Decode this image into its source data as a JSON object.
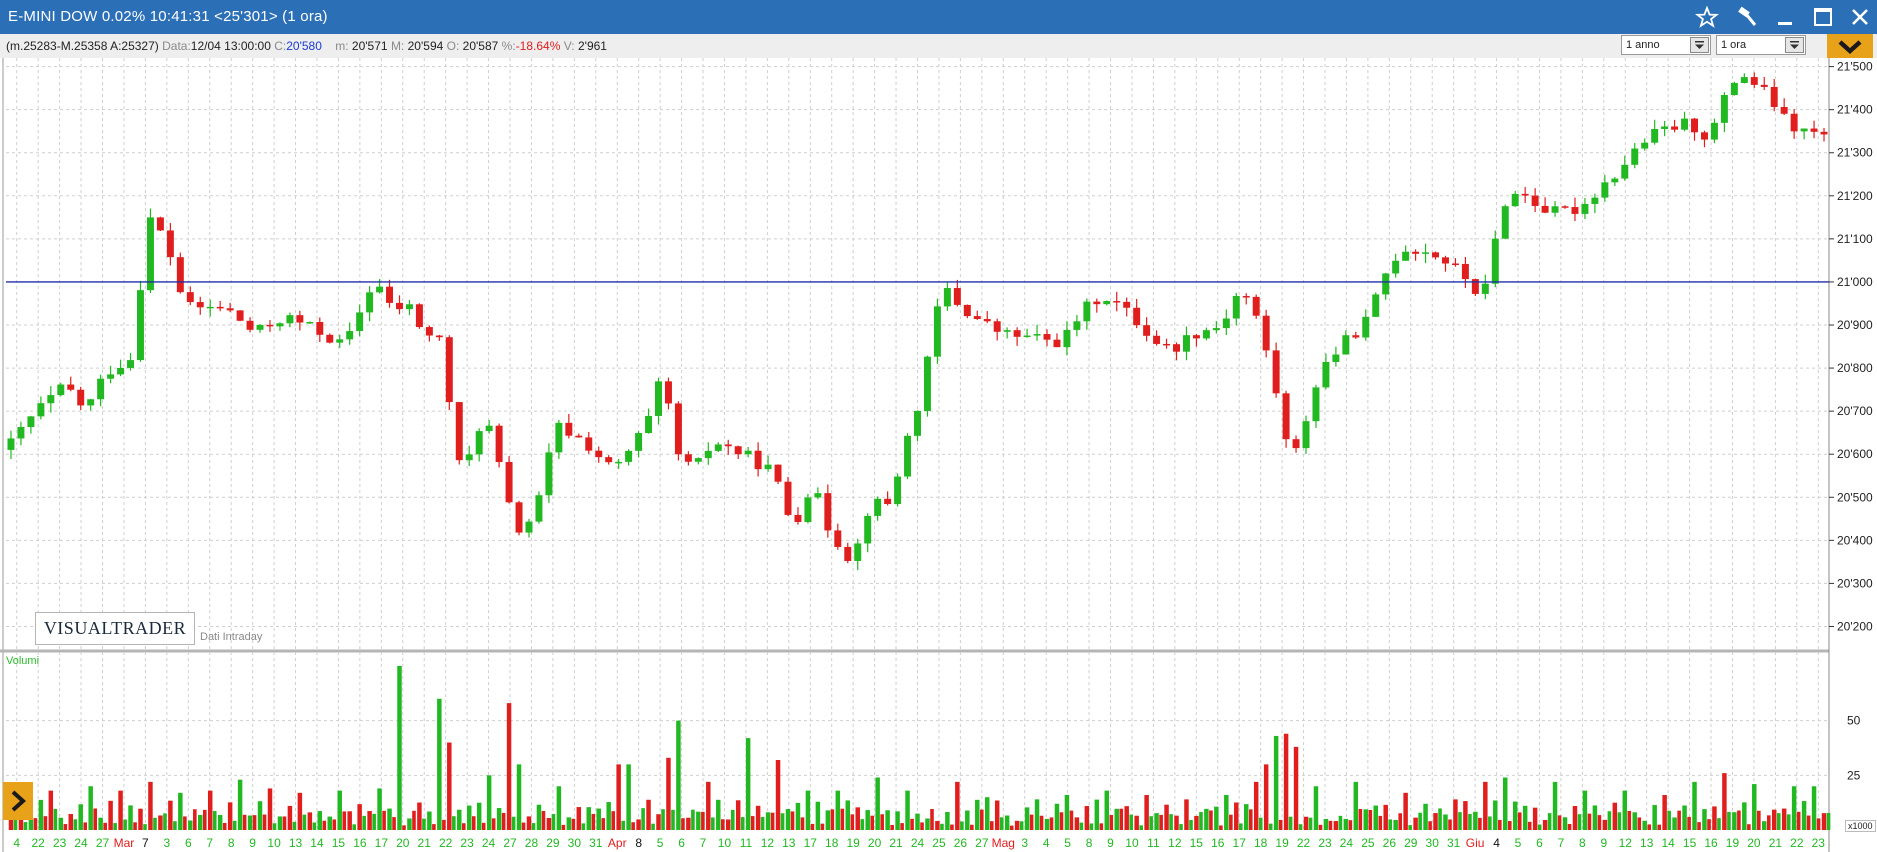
{
  "window": {
    "title": "E-MINI DOW 0.02% 10:41:31  <25'301> (1 ora)",
    "controls": [
      "star-icon",
      "hammer-icon",
      "minimize-icon",
      "maximize-icon",
      "close-icon"
    ]
  },
  "infobar": {
    "range": "(m.25283-M.25358 A:25327)",
    "date_label": "Data:",
    "date_value": "12/04 13:00:00",
    "close_label": "C:",
    "close_value": "20'580",
    "min_label": "m:",
    "min_value": "20'571",
    "max_label": "M:",
    "max_value": "20'594",
    "open_label": "O:",
    "open_value": "20'587",
    "pct_label": "%:",
    "pct_value": "-18.64%",
    "vol_label": "V:",
    "vol_value": "2'961",
    "period_select": "1 anno",
    "interval_select": "1 ora"
  },
  "watermark": {
    "logo": "VISUALTRADER",
    "data_label": "Dati Intraday"
  },
  "volume": {
    "label": "Volumi",
    "multiplier": "x1000"
  },
  "colors": {
    "up": "#22b822",
    "down": "#e01e1e",
    "reference_line": "#1f2ea8",
    "grid": "#cfcfcf",
    "titlebar": "#2b6fb6",
    "accent": "#e8a21a"
  },
  "chart_data": [
    {
      "type": "candlestick",
      "title": "E-MINI DOW",
      "xlabel": "",
      "ylabel": "",
      "ylim": [
        20150,
        21520
      ],
      "y_ticks": [
        20200,
        20300,
        20400,
        20500,
        20600,
        20700,
        20800,
        20900,
        21000,
        21100,
        21200,
        21300,
        21400,
        21500
      ],
      "y_tick_labels": [
        "20'200",
        "20'300",
        "20'400",
        "20'500",
        "20'600",
        "20'700",
        "20'800",
        "20'900",
        "21'000",
        "21'100",
        "21'200",
        "21'300",
        "21'400",
        "21'500"
      ],
      "reference_line": 21000,
      "grid": true,
      "x_tick_labels": [
        {
          "label": "4",
          "color": "green"
        },
        {
          "label": "22",
          "color": "green"
        },
        {
          "label": "23",
          "color": "green"
        },
        {
          "label": "24",
          "color": "green"
        },
        {
          "label": "27",
          "color": "green"
        },
        {
          "label": "Mar",
          "color": "red"
        },
        {
          "label": "7",
          "color": "black"
        },
        {
          "label": "3",
          "color": "green"
        },
        {
          "label": "6",
          "color": "green"
        },
        {
          "label": "7",
          "color": "green"
        },
        {
          "label": "8",
          "color": "green"
        },
        {
          "label": "9",
          "color": "green"
        },
        {
          "label": "10",
          "color": "green"
        },
        {
          "label": "13",
          "color": "green"
        },
        {
          "label": "14",
          "color": "green"
        },
        {
          "label": "15",
          "color": "green"
        },
        {
          "label": "16",
          "color": "green"
        },
        {
          "label": "17",
          "color": "green"
        },
        {
          "label": "20",
          "color": "green"
        },
        {
          "label": "21",
          "color": "green"
        },
        {
          "label": "22",
          "color": "green"
        },
        {
          "label": "23",
          "color": "green"
        },
        {
          "label": "24",
          "color": "green"
        },
        {
          "label": "27",
          "color": "green"
        },
        {
          "label": "28",
          "color": "green"
        },
        {
          "label": "29",
          "color": "green"
        },
        {
          "label": "30",
          "color": "green"
        },
        {
          "label": "31",
          "color": "green"
        },
        {
          "label": "Apr",
          "color": "red"
        },
        {
          "label": "8",
          "color": "black"
        },
        {
          "label": "5",
          "color": "green"
        },
        {
          "label": "6",
          "color": "green"
        },
        {
          "label": "7",
          "color": "green"
        },
        {
          "label": "10",
          "color": "green"
        },
        {
          "label": "11",
          "color": "green"
        },
        {
          "label": "12",
          "color": "green"
        },
        {
          "label": "13",
          "color": "green"
        },
        {
          "label": "17",
          "color": "green"
        },
        {
          "label": "18",
          "color": "green"
        },
        {
          "label": "19",
          "color": "green"
        },
        {
          "label": "20",
          "color": "green"
        },
        {
          "label": "21",
          "color": "green"
        },
        {
          "label": "24",
          "color": "green"
        },
        {
          "label": "25",
          "color": "green"
        },
        {
          "label": "26",
          "color": "green"
        },
        {
          "label": "27",
          "color": "green"
        },
        {
          "label": "Mag",
          "color": "red"
        },
        {
          "label": "3",
          "color": "green"
        },
        {
          "label": "4",
          "color": "green"
        },
        {
          "label": "5",
          "color": "green"
        },
        {
          "label": "8",
          "color": "green"
        },
        {
          "label": "9",
          "color": "green"
        },
        {
          "label": "10",
          "color": "green"
        },
        {
          "label": "11",
          "color": "green"
        },
        {
          "label": "12",
          "color": "green"
        },
        {
          "label": "15",
          "color": "green"
        },
        {
          "label": "16",
          "color": "green"
        },
        {
          "label": "17",
          "color": "green"
        },
        {
          "label": "18",
          "color": "green"
        },
        {
          "label": "19",
          "color": "green"
        },
        {
          "label": "22",
          "color": "green"
        },
        {
          "label": "23",
          "color": "green"
        },
        {
          "label": "24",
          "color": "green"
        },
        {
          "label": "25",
          "color": "green"
        },
        {
          "label": "26",
          "color": "green"
        },
        {
          "label": "29",
          "color": "green"
        },
        {
          "label": "30",
          "color": "green"
        },
        {
          "label": "31",
          "color": "green"
        },
        {
          "label": "Giu",
          "color": "red"
        },
        {
          "label": "4",
          "color": "black"
        },
        {
          "label": "5",
          "color": "green"
        },
        {
          "label": "6",
          "color": "green"
        },
        {
          "label": "7",
          "color": "green"
        },
        {
          "label": "8",
          "color": "green"
        },
        {
          "label": "9",
          "color": "green"
        },
        {
          "label": "12",
          "color": "green"
        },
        {
          "label": "13",
          "color": "green"
        },
        {
          "label": "14",
          "color": "green"
        },
        {
          "label": "15",
          "color": "green"
        },
        {
          "label": "16",
          "color": "green"
        },
        {
          "label": "19",
          "color": "green"
        },
        {
          "label": "20",
          "color": "green"
        },
        {
          "label": "21",
          "color": "green"
        },
        {
          "label": "22",
          "color": "green"
        },
        {
          "label": "23",
          "color": "green"
        }
      ],
      "price_path": [
        [
          0,
          20610
        ],
        [
          3,
          20700
        ],
        [
          6,
          20760
        ],
        [
          8,
          20700
        ],
        [
          10,
          20790
        ],
        [
          13,
          20830
        ],
        [
          14,
          21160
        ],
        [
          16,
          21100
        ],
        [
          18,
          20940
        ],
        [
          22,
          20940
        ],
        [
          25,
          20880
        ],
        [
          28,
          20920
        ],
        [
          31,
          20890
        ],
        [
          34,
          20850
        ],
        [
          37,
          21010
        ],
        [
          39,
          20920
        ],
        [
          40,
          20960
        ],
        [
          42,
          20880
        ],
        [
          44,
          20860
        ],
        [
          45,
          20590
        ],
        [
          46,
          20560
        ],
        [
          48,
          20700
        ],
        [
          49,
          20620
        ],
        [
          51,
          20430
        ],
        [
          52,
          20420
        ],
        [
          54,
          20520
        ],
        [
          55,
          20670
        ],
        [
          58,
          20630
        ],
        [
          61,
          20560
        ],
        [
          63,
          20620
        ],
        [
          65,
          20700
        ],
        [
          66,
          20810
        ],
        [
          67,
          20610
        ],
        [
          69,
          20560
        ],
        [
          71,
          20630
        ],
        [
          74,
          20600
        ],
        [
          77,
          20560
        ],
        [
          79,
          20430
        ],
        [
          81,
          20540
        ],
        [
          82,
          20450
        ],
        [
          84,
          20380
        ],
        [
          85,
          20350
        ],
        [
          87,
          20510
        ],
        [
          88,
          20460
        ],
        [
          89,
          20510
        ],
        [
          90,
          20600
        ],
        [
          92,
          20750
        ],
        [
          94,
          21000
        ],
        [
          95,
          20960
        ],
        [
          97,
          20920
        ],
        [
          100,
          20880
        ],
        [
          103,
          20870
        ],
        [
          106,
          20860
        ],
        [
          108,
          20930
        ],
        [
          110,
          20970
        ],
        [
          111,
          20960
        ],
        [
          113,
          20920
        ],
        [
          115,
          20870
        ],
        [
          117,
          20840
        ],
        [
          119,
          20880
        ],
        [
          122,
          20900
        ],
        [
          124,
          20990
        ],
        [
          126,
          20890
        ],
        [
          127,
          20790
        ],
        [
          128,
          20700
        ],
        [
          129,
          20560
        ],
        [
          130,
          20650
        ],
        [
          131,
          20720
        ],
        [
          132,
          20800
        ],
        [
          134,
          20850
        ],
        [
          137,
          20920
        ],
        [
          138,
          21000
        ],
        [
          140,
          21080
        ],
        [
          143,
          21070
        ],
        [
          145,
          21040
        ],
        [
          147,
          21000
        ],
        [
          148,
          20960
        ],
        [
          149,
          21010
        ],
        [
          150,
          21180
        ],
        [
          152,
          21210
        ],
        [
          155,
          21160
        ],
        [
          158,
          21170
        ],
        [
          160,
          21220
        ],
        [
          162,
          21260
        ],
        [
          164,
          21320
        ],
        [
          166,
          21350
        ],
        [
          169,
          21370
        ],
        [
          171,
          21330
        ],
        [
          172,
          21400
        ],
        [
          174,
          21490
        ],
        [
          177,
          21430
        ],
        [
          179,
          21360
        ],
        [
          182,
          21340
        ]
      ],
      "volume_ylim": [
        0,
        80
      ],
      "volume_ticks": [
        25,
        50
      ],
      "volume_peaks": [
        [
          4,
          18
        ],
        [
          8,
          20
        ],
        [
          11,
          18
        ],
        [
          14,
          22
        ],
        [
          17,
          17
        ],
        [
          20,
          18
        ],
        [
          23,
          23
        ],
        [
          26,
          19
        ],
        [
          29,
          17
        ],
        [
          33,
          18
        ],
        [
          37,
          19
        ],
        [
          39,
          75
        ],
        [
          43,
          60
        ],
        [
          44,
          40
        ],
        [
          48,
          25
        ],
        [
          50,
          58
        ],
        [
          51,
          30
        ],
        [
          55,
          20
        ],
        [
          61,
          30
        ],
        [
          62,
          30
        ],
        [
          66,
          33
        ],
        [
          67,
          50
        ],
        [
          70,
          22
        ],
        [
          74,
          42
        ],
        [
          77,
          32
        ],
        [
          80,
          18
        ],
        [
          83,
          18
        ],
        [
          87,
          24
        ],
        [
          90,
          18
        ],
        [
          95,
          22
        ],
        [
          98,
          15
        ],
        [
          103,
          14
        ],
        [
          106,
          16
        ],
        [
          110,
          18
        ],
        [
          114,
          16
        ],
        [
          118,
          14
        ],
        [
          122,
          16
        ],
        [
          125,
          22
        ],
        [
          126,
          30
        ],
        [
          127,
          43
        ],
        [
          128,
          44
        ],
        [
          129,
          38
        ],
        [
          131,
          20
        ],
        [
          135,
          22
        ],
        [
          140,
          17
        ],
        [
          145,
          14
        ],
        [
          148,
          22
        ],
        [
          150,
          24
        ],
        [
          155,
          22
        ],
        [
          158,
          18
        ],
        [
          162,
          18
        ],
        [
          166,
          16
        ],
        [
          169,
          22
        ],
        [
          172,
          26
        ],
        [
          175,
          21
        ],
        [
          179,
          20
        ],
        [
          181,
          20
        ]
      ]
    }
  ]
}
